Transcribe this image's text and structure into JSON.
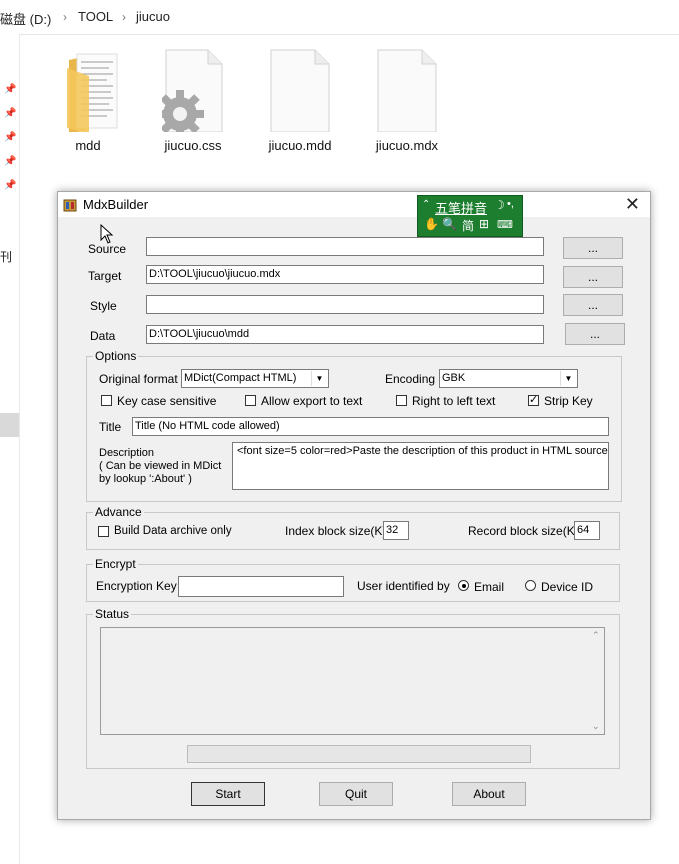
{
  "explorer": {
    "breadcrumb": [
      "磁盘 (D:)",
      "TOOL",
      "jiucuo"
    ],
    "left_text": "刊",
    "files": [
      {
        "name": "mdd",
        "type": "folder"
      },
      {
        "name": "jiucuo.css",
        "type": "css"
      },
      {
        "name": "jiucuo.mdd",
        "type": "file"
      },
      {
        "name": "jiucuo.mdx",
        "type": "file"
      }
    ]
  },
  "ime": {
    "label": "五笔拼音",
    "simplified": "简",
    "moon": "☽",
    "punct": "•,"
  },
  "dialog": {
    "title": "MdxBuilder",
    "source_label": "Source",
    "source_value": "",
    "target_label": "Target",
    "target_value": "D:\\TOOL\\jiucuo\\jiucuo.mdx",
    "style_label": "Style",
    "style_value": "",
    "data_label": "Data",
    "data_value": "D:\\TOOL\\jiucuo\\mdd",
    "browse_label": "...",
    "options": {
      "legend": "Options",
      "format_label": "Original format",
      "format_value": "MDict(Compact HTML)",
      "encoding_label": "Encoding",
      "encoding_value": "GBK",
      "key_case": "Key case sensitive",
      "allow_export": "Allow export to text",
      "rtl": "Right to left text",
      "strip_key": "Strip Key",
      "title_label": "Title",
      "title_value": "Title (No HTML code allowed)",
      "desc_label_1": "Description",
      "desc_label_2": "( Can be viewed in MDict",
      "desc_label_3": "by lookup ':About' )",
      "desc_value": "<font size=5 color=red>Paste the description of this product in HTML source"
    },
    "advance": {
      "legend": "Advance",
      "build_data": "Build Data archive only",
      "index_label": "Index block size(K)",
      "index_value": "32",
      "record_label": "Record block size(K)",
      "record_value": "64"
    },
    "encrypt": {
      "legend": "Encrypt",
      "key_label": "Encryption Key",
      "key_value": "",
      "user_label": "User identified by",
      "email": "Email",
      "device": "Device ID"
    },
    "status": {
      "legend": "Status"
    },
    "buttons": {
      "start": "Start",
      "quit": "Quit",
      "about": "About"
    }
  }
}
